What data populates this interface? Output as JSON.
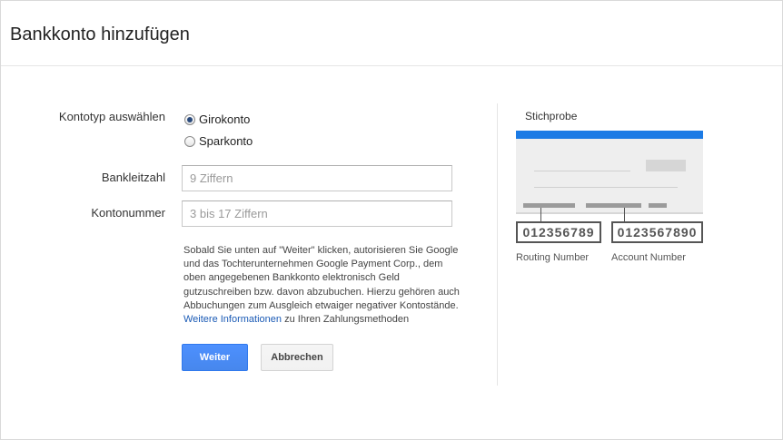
{
  "page": {
    "title": "Bankkonto hinzufügen"
  },
  "form": {
    "account_type_label": "Kontotyp auswählen",
    "account_types": [
      {
        "label": "Girokonto",
        "checked": true
      },
      {
        "label": "Sparkonto",
        "checked": false
      }
    ],
    "bank_code_label": "Bankleitzahl",
    "bank_code_placeholder": "9 Ziffern",
    "bank_code_value": "",
    "account_number_label": "Kontonummer",
    "account_number_placeholder": "3 bis 17 Ziffern",
    "account_number_value": "",
    "disclaimer_text": "Sobald Sie unten auf \"Weiter\" klicken, autorisieren Sie Google und das Tochterunternehmen Google Payment Corp., dem oben angegebenen Bankkonto elektronisch Geld gutzuschreiben bzw. davon abzubuchen. Hierzu gehören auch Abbuchungen zum Ausgleich etwaiger negativer Kontostände.",
    "disclaimer_link": "Weitere Informationen",
    "disclaimer_suffix": "zu Ihren Zahlungsmethoden",
    "submit_label": "Weiter",
    "cancel_label": "Abbrechen"
  },
  "sample": {
    "title": "Stichprobe",
    "routing_number": "012356789",
    "account_number": "0123567890",
    "routing_caption": "Routing Number",
    "account_caption": "Account Number",
    "bar_color": "#1c7be5"
  },
  "colors": {
    "primary_button": "#4d90fe",
    "link": "#1a5ab5"
  }
}
